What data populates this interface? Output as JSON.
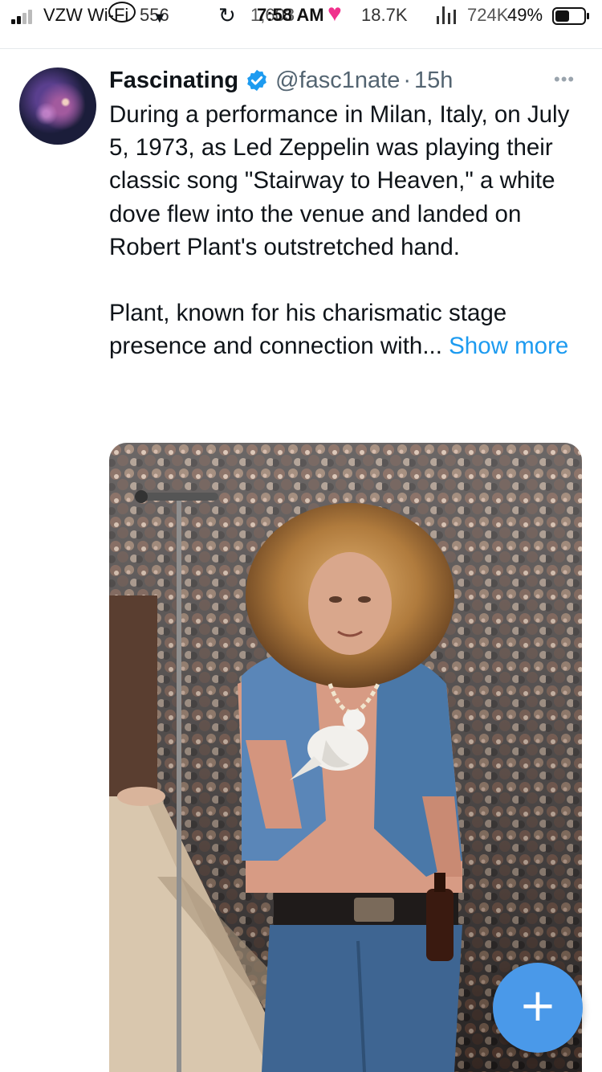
{
  "status_bar": {
    "carrier": "VZW Wi-Fi",
    "notif_count_1": "556",
    "retweet_count": "1,603",
    "time": "7:58 AM",
    "likes": "18.7K",
    "views": "724K",
    "battery": "49%",
    "battery_level": 0.49
  },
  "tweet": {
    "author_name": "Fascinating",
    "handle": "@fasc1nate",
    "separator": "·",
    "time": "15h",
    "paragraph_1": "During a performance in Milan, Italy, on July 5, 1973, as Led Zeppelin was playing their classic song \"Stairway to Heaven,\" a white dove flew into the venue and landed on Robert Plant's outstretched hand.",
    "paragraph_2": "Plant, known for his charismatic stage presence and connection with...",
    "show_more": "Show more"
  },
  "colors": {
    "accent": "#1d9bf0",
    "fab": "#4a99e9",
    "like_heart": "#f0308c",
    "muted": "#536471"
  },
  "icons": {
    "verified": "verified-badge-icon",
    "more": "more-horizontal-icon",
    "compose": "plus-icon"
  }
}
